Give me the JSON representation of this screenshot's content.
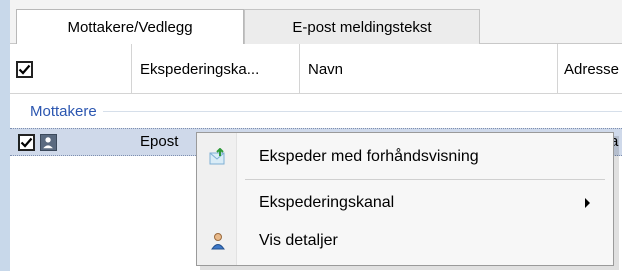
{
  "tabs": [
    {
      "label": "Mottakere/Vedlegg",
      "active": true
    },
    {
      "label": "E-post meldingstekst",
      "active": false
    }
  ],
  "grid": {
    "columns": {
      "kanal": "Ekspederingska...",
      "navn": "Navn",
      "adresse": "Adresse"
    },
    "header_checked": true,
    "group_label": "Mottakere",
    "row": {
      "checked": true,
      "icon": "user-icon",
      "kanal": "Epost",
      "adresse_fragment": "a"
    }
  },
  "context_menu": {
    "items": [
      {
        "label": "Ekspeder med forhåndsvisning",
        "icon": "send-preview-icon"
      },
      {
        "label": "Ekspederingskanal",
        "icon": "none",
        "submenu": true
      },
      {
        "label": "Vis detaljer",
        "icon": "person-details-icon"
      }
    ]
  },
  "colors": {
    "accent_blue": "#2b56b0",
    "selected_row": "#cfd9ea",
    "left_bar": "#c8d8ea"
  }
}
